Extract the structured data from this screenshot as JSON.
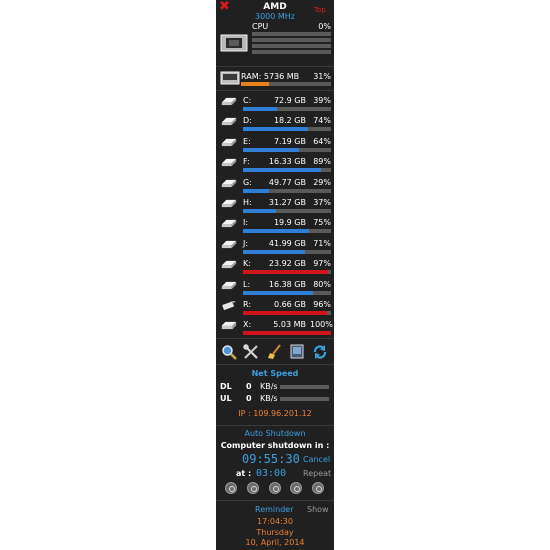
{
  "header": {
    "close_icon": "x-icon",
    "cpu_name": "AMD",
    "cpu_freq": "3000 MHz",
    "top_label": "Top",
    "cpu_label": "CPU",
    "cpu_percent": "0%",
    "cpu_usage": 0
  },
  "ram": {
    "label": "RAM: 5736 MB",
    "percent": "31%",
    "usage": 0.31
  },
  "drives": [
    {
      "letter": "C:",
      "size": "72.9 GB",
      "percent": "39%",
      "usage": 0.39,
      "type": "hdd"
    },
    {
      "letter": "D:",
      "size": "18.2 GB",
      "percent": "74%",
      "usage": 0.74,
      "type": "hdd"
    },
    {
      "letter": "E:",
      "size": "7.19 GB",
      "percent": "64%",
      "usage": 0.64,
      "type": "hdd"
    },
    {
      "letter": "F:",
      "size": "16.33 GB",
      "percent": "89%",
      "usage": 0.89,
      "type": "hdd"
    },
    {
      "letter": "G:",
      "size": "49.77 GB",
      "percent": "29%",
      "usage": 0.29,
      "type": "hdd"
    },
    {
      "letter": "H:",
      "size": "31.27 GB",
      "percent": "37%",
      "usage": 0.37,
      "type": "hdd"
    },
    {
      "letter": "I:",
      "size": "19.9 GB",
      "percent": "75%",
      "usage": 0.75,
      "type": "hdd"
    },
    {
      "letter": "J:",
      "size": "41.99 GB",
      "percent": "71%",
      "usage": 0.71,
      "type": "hdd"
    },
    {
      "letter": "K:",
      "size": "23.92 GB",
      "percent": "97%",
      "usage": 0.97,
      "type": "hdd"
    },
    {
      "letter": "L:",
      "size": "16.38 GB",
      "percent": "80%",
      "usage": 0.8,
      "type": "hdd"
    },
    {
      "letter": "R:",
      "size": "0.66 GB",
      "percent": "96%",
      "usage": 0.96,
      "type": "usb"
    },
    {
      "letter": "X:",
      "size": "5.03 MB",
      "percent": "100%",
      "usage": 1.0,
      "type": "optical"
    }
  ],
  "tools": [
    "search-icon",
    "settings-tools-icon",
    "cleanup-broom-icon",
    "monitor-icon",
    "refresh-icon"
  ],
  "net": {
    "title": "Net  Speed",
    "dl_label": "DL",
    "dl_value": "0",
    "dl_unit": "KB/s",
    "ul_label": "UL",
    "ul_value": "0",
    "ul_unit": "KB/s",
    "ip": "IP :  109.96.201.12"
  },
  "shutdown": {
    "title": "Auto Shutdown",
    "message": "Computer shutdown in :",
    "countdown": "09:55:30",
    "cancel": "Cancel",
    "at_label": "at :",
    "at_time": "03:00",
    "repeat": "Repeat",
    "buttons": [
      "power-off-button",
      "restart-button",
      "standby-button",
      "hibernate-button",
      "logoff-button"
    ]
  },
  "reminder": {
    "title": "Reminder",
    "show": "Show",
    "time": "17:04:30",
    "weekday": "Thursday",
    "date": "10, April, 2014"
  },
  "colors": {
    "panel": "#202020",
    "blue": "#3aa0e0",
    "orange": "#f08030",
    "bar_bg": "#5a5a5a",
    "bar_blue": "#2f7fd6",
    "bar_red": "#d0141a",
    "bar_orange": "#e8801c"
  }
}
